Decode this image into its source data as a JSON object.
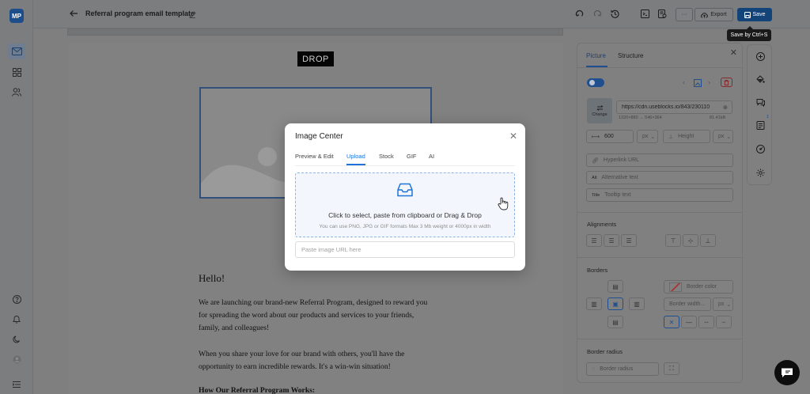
{
  "app": {
    "logo_text": "MP"
  },
  "topbar": {
    "title": "Referral program email template",
    "export_label": "Export",
    "save_label": "Save",
    "save_tooltip": "Save by Ctrl+S",
    "more_label": "···"
  },
  "email": {
    "brand_text": "DROP",
    "greeting": "Hello!",
    "paragraph1": "We are launching our brand-new Referral Program, designed to reward you for spreading the word about our products and services to your friends, family, and colleagues!",
    "paragraph2": "When you share your love for our brand with others, you'll have the opportunity to earn incredible rewards. It's a win-win situation!",
    "heading_partial": "How Our Referral Program Works:"
  },
  "panel": {
    "tabs": [
      "Picture",
      "Structure"
    ],
    "active_tab": "Picture",
    "image_url": "https://cdn.useblocks.io/843/230110",
    "image_dims": "1320×880 → 546×364",
    "image_size": "81.41kB",
    "change_label": "Change",
    "width_value": "600",
    "width_unit": "px",
    "height_placeholder": "Height",
    "height_unit": "px",
    "hyperlink_placeholder": "Hyperlink URL",
    "alt_prefix": "Alt",
    "alt_placeholder": "Alternative text",
    "title_prefix": "Title",
    "title_placeholder": "Tooltip text",
    "alignments_label": "Alignments",
    "borders_label": "Borders",
    "border_color_placeholder": "Border color",
    "border_width_placeholder": "Border width...",
    "border_width_unit": "px",
    "border_radius_label": "Border radius",
    "border_radius_placeholder": "Border radius"
  },
  "right_rail": {
    "badge": "1"
  },
  "modal": {
    "title": "Image Center",
    "tabs": [
      "Preview & Edit",
      "Upload",
      "Stock",
      "GIF",
      "AI"
    ],
    "active_tab": "Upload",
    "drop_main": "Click to select, paste from clipboard or Drag & Drop",
    "drop_sub": "You can use PNG, JPG or GIF formats Max 3 Mb weight or 4000px in width",
    "url_placeholder": "Paste image URL here"
  },
  "colors": {
    "accent": "#1f73d6",
    "save": "#12447a",
    "overlay": "#7f7f80"
  }
}
